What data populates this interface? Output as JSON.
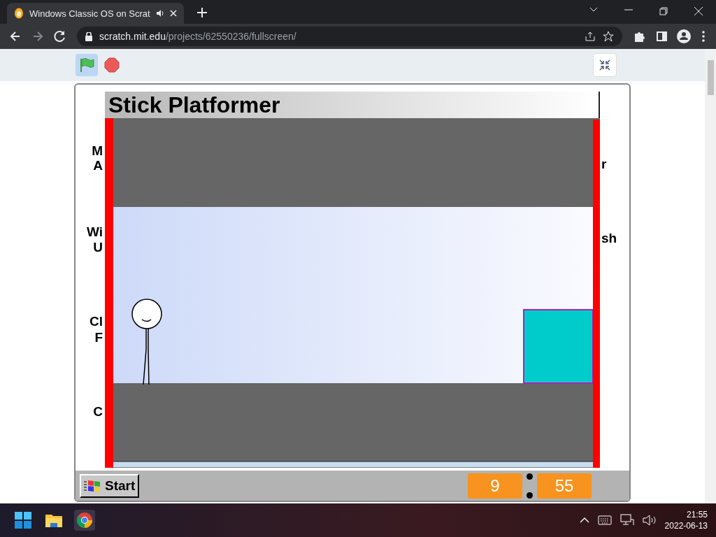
{
  "browser": {
    "tabs": [
      {
        "title": "Windows Classic OS on Scrat",
        "selected": true
      }
    ],
    "address": {
      "host": "scratch.mit.edu",
      "path": "/projects/62550236/fullscreen/"
    }
  },
  "stage": {
    "desktop_labels": [
      {
        "text": "M"
      },
      {
        "text": "A"
      },
      {
        "text": "Wi"
      },
      {
        "text": "U"
      },
      {
        "text": "Cl"
      },
      {
        "text": "F"
      },
      {
        "text": "C"
      },
      {
        "text": "r"
      },
      {
        "text": "sh"
      }
    ],
    "game": {
      "title": "Stick Platformer"
    },
    "taskbar": {
      "start": "Start",
      "timer": [
        "9",
        "55"
      ]
    }
  },
  "os_taskbar": {
    "time": "21:55",
    "date": "2022-06-13"
  }
}
